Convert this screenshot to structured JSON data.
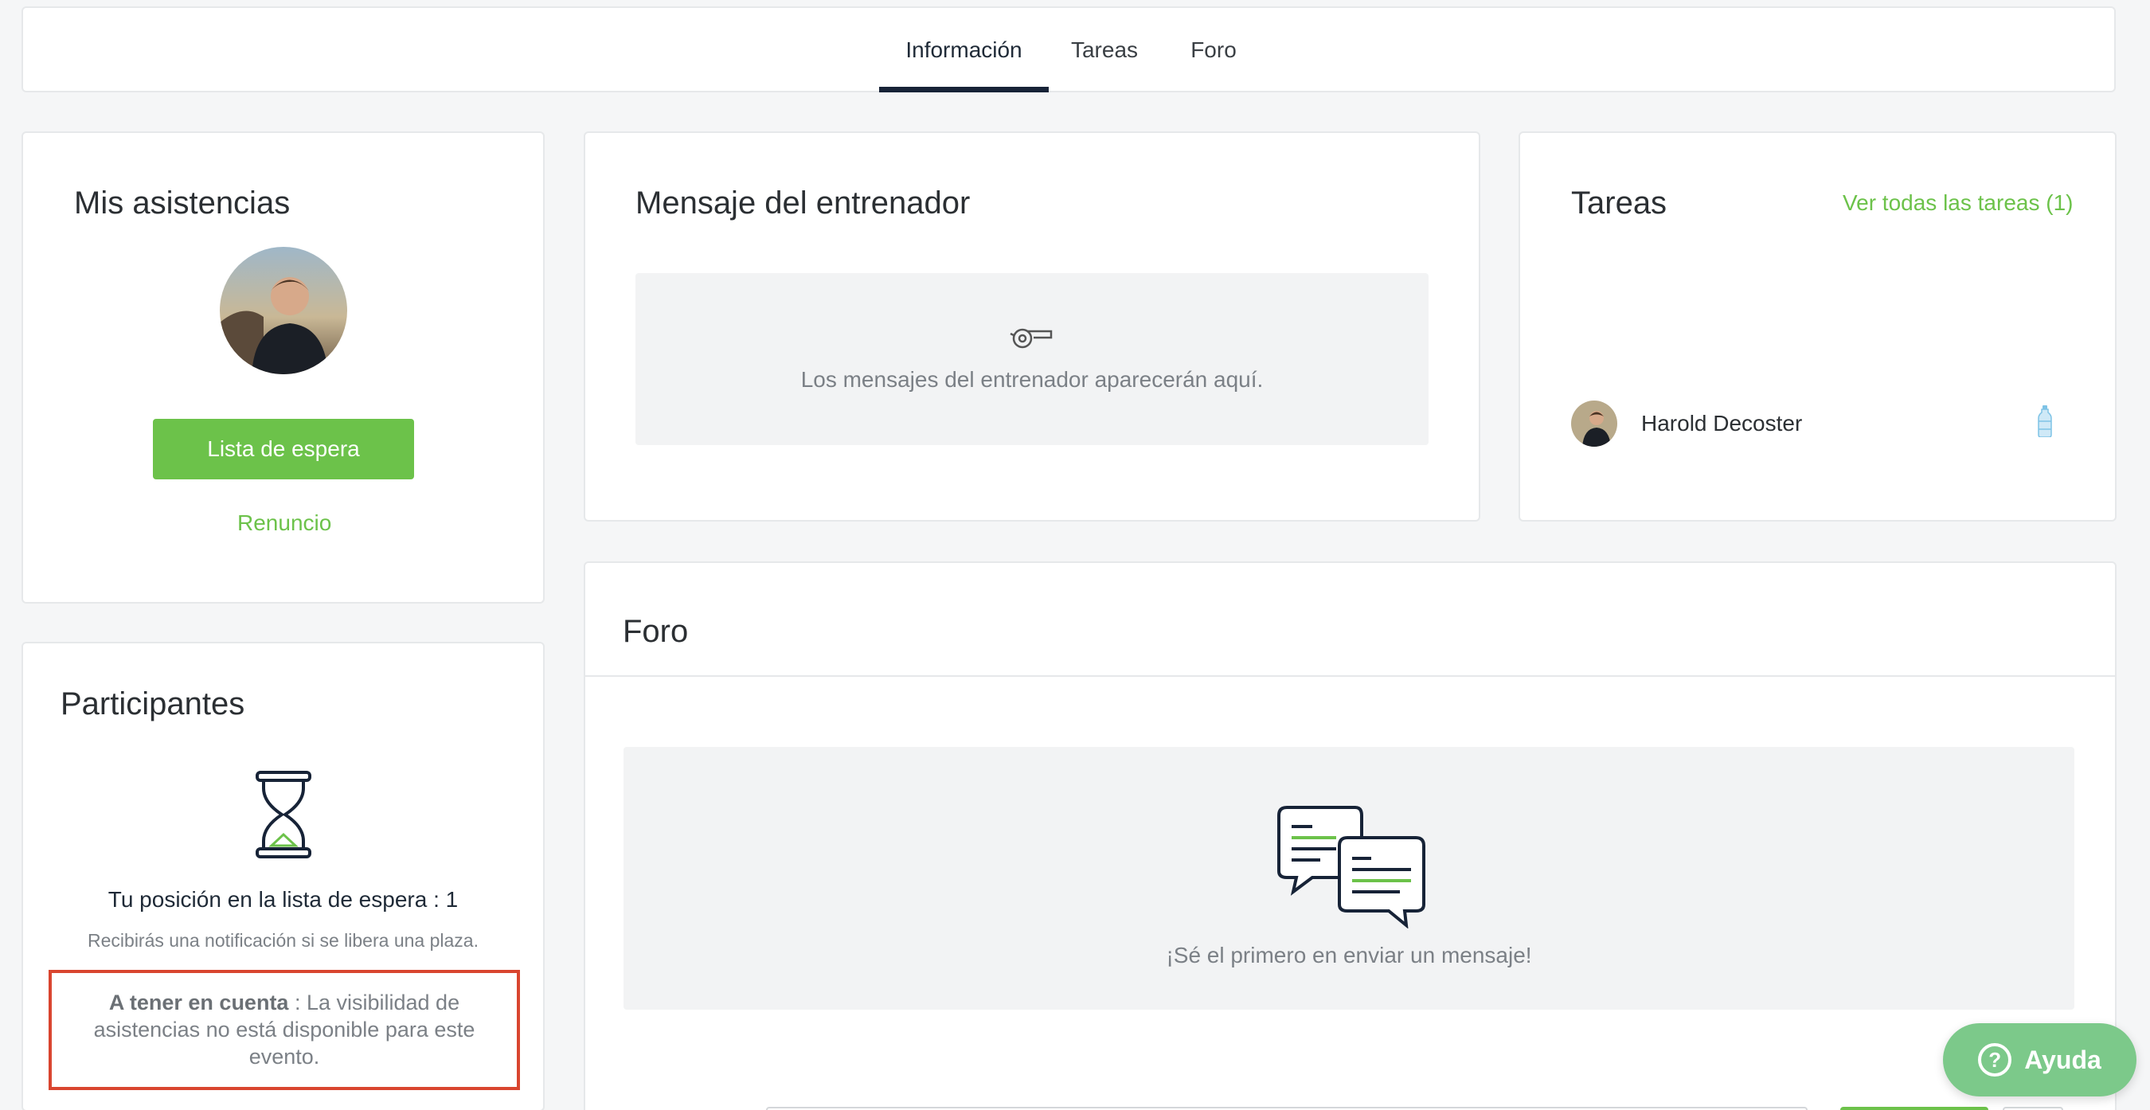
{
  "tabs": [
    {
      "label": "Información",
      "active": true
    },
    {
      "label": "Tareas",
      "active": false
    },
    {
      "label": "Foro",
      "active": false
    }
  ],
  "asistencias": {
    "title": "Mis asistencias",
    "waitlist_button": "Lista de espera",
    "renounce_link": "Renuncio"
  },
  "mensaje": {
    "title": "Mensaje del entrenador",
    "empty_text": "Los mensajes del entrenador aparecerán aquí.",
    "icon": "whistle-icon"
  },
  "tareas": {
    "title": "Tareas",
    "view_all_link": "Ver todas las tareas (1)",
    "assignee": "Harold Decoster",
    "task_icon": "water-bottle-icon"
  },
  "participantes": {
    "title": "Participantes",
    "position_text": "Tu posición en la lista de espera : 1",
    "notify_text": "Recibirás una notificación si se libera una plaza.",
    "notice_bold": "A tener en cuenta",
    "notice_text": " : La visibilidad de asistencias no está disponible para este evento."
  },
  "foro": {
    "title": "Foro",
    "empty_text": "¡Sé el primero en enviar un mensaje!"
  },
  "help": {
    "label": "Ayuda"
  },
  "colors": {
    "accent_green": "#6cc24a",
    "active_tab": "#172337",
    "notice_border": "#d9452f",
    "help_button": "#7cc98a"
  }
}
